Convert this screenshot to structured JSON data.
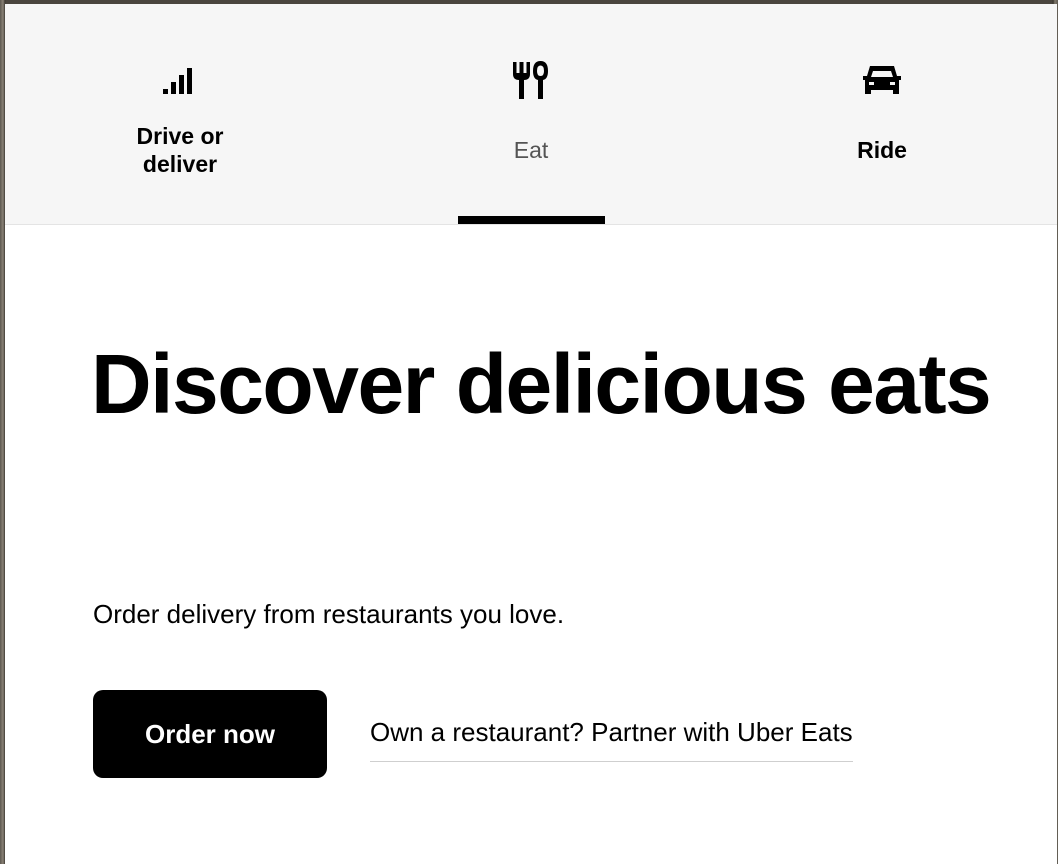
{
  "nav": {
    "tabs": [
      {
        "label": "Drive or deliver",
        "icon": "signal-bars-icon",
        "active": false
      },
      {
        "label": "Eat",
        "icon": "fork-knife-icon",
        "active": true
      },
      {
        "label": "Ride",
        "icon": "car-icon",
        "active": false
      }
    ]
  },
  "hero": {
    "headline": "Discover delicious eats",
    "subtitle": "Order delivery from restaurants you love.",
    "order_button": "Order now",
    "partner_link": "Own a restaurant? Partner with Uber Eats"
  },
  "colors": {
    "accent": "#000000",
    "tabbar_bg": "#f6f6f6",
    "inactive_label": "#545454"
  }
}
